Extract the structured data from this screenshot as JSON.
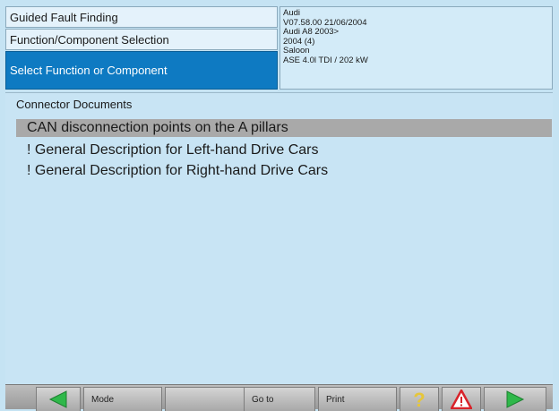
{
  "header": {
    "nav_level_1": "Guided Fault Finding",
    "nav_level_2": "Function/Component Selection",
    "nav_level_3": "Select Function or Component"
  },
  "vehicle": {
    "make": "Audi",
    "version": "V07.58.00 21/06/2004",
    "model": "Audi A8 2003>",
    "year": "2004 (4)",
    "body": "Saloon",
    "engine": "ASE 4.0l TDI / 202 kW"
  },
  "main": {
    "section_title": "Connector Documents",
    "items": [
      {
        "label": "CAN disconnection points on the A pillars",
        "selected": true
      },
      {
        "label": "! General Description for Left-hand Drive Cars",
        "selected": false
      },
      {
        "label": "! General Description for Right-hand Drive Cars",
        "selected": false
      }
    ]
  },
  "toolbar": {
    "mode_label": "Mode",
    "goto_label": "Go to",
    "print_label": "Print",
    "icons": [
      "back-arrow-icon",
      "help-icon",
      "warning-icon",
      "forward-arrow-icon"
    ]
  },
  "colors": {
    "background": "#c5e3f3",
    "active_nav": "#0e7ac2",
    "selected_row": "#a9a9a9",
    "arrow_green": "#2fb84a",
    "help_yellow": "#e6c63a",
    "warning_red": "#d8232a"
  }
}
